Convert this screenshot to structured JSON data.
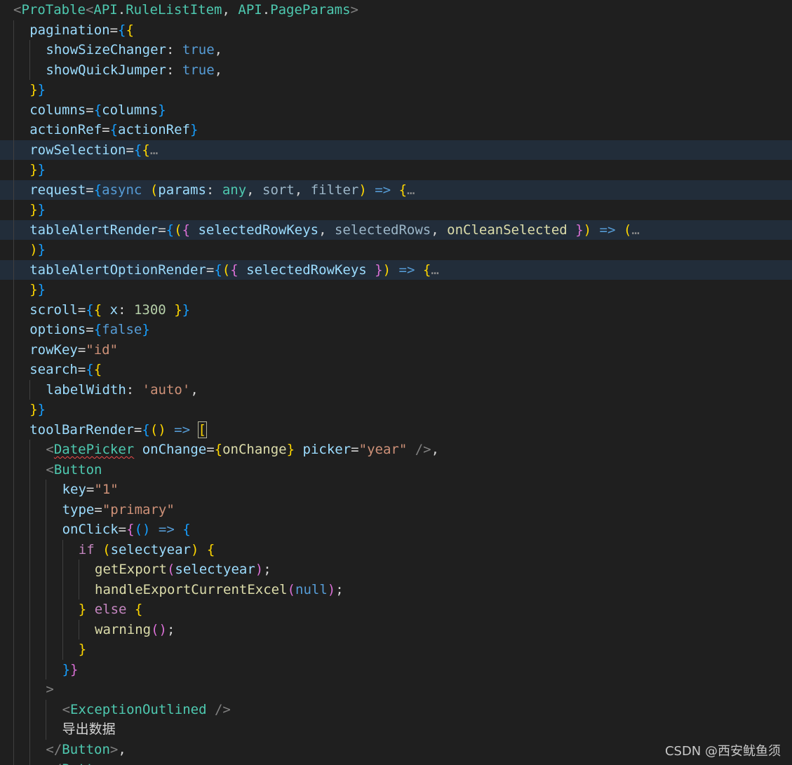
{
  "watermark": "CSDN @西安鱿鱼须",
  "colors": {
    "background": "#1f1f1f",
    "folded_line_highlight": "#222d3a",
    "indent_guide": "#404040",
    "tag": "#4ec9b0",
    "attribute": "#9cdcfe",
    "keyword": "#569cd6",
    "control": "#c586c0",
    "string": "#ce9178",
    "number": "#b5cea8",
    "function": "#dcdcaa",
    "bracket_level_1": "#ffd700",
    "bracket_level_2": "#da70d6",
    "bracket_level_3": "#179fff",
    "error_squiggle": "#f14c4c"
  },
  "lines": [
    {
      "indent": 0,
      "tokens": [
        [
          "t-tagbr",
          "<"
        ],
        [
          "t-tag",
          "ProTable"
        ],
        [
          "t-tagbr",
          "<"
        ],
        [
          "t-type",
          "API"
        ],
        [
          "t-op",
          "."
        ],
        [
          "t-type",
          "RuleListItem"
        ],
        [
          "t-op",
          ", "
        ],
        [
          "t-type",
          "API"
        ],
        [
          "t-op",
          "."
        ],
        [
          "t-type",
          "PageParams"
        ],
        [
          "t-tagbr",
          ">"
        ]
      ]
    },
    {
      "indent": 1,
      "tokens": [
        [
          "t-attr",
          "pagination"
        ],
        [
          "t-op",
          "="
        ],
        [
          "b3",
          "{"
        ],
        [
          "b1",
          "{"
        ]
      ]
    },
    {
      "indent": 2,
      "tokens": [
        [
          "t-var",
          "showSizeChanger"
        ],
        [
          "t-op",
          ": "
        ],
        [
          "t-kw",
          "true"
        ],
        [
          "t-op",
          ","
        ]
      ]
    },
    {
      "indent": 2,
      "tokens": [
        [
          "t-var",
          "showQuickJumper"
        ],
        [
          "t-op",
          ": "
        ],
        [
          "t-kw",
          "true"
        ],
        [
          "t-op",
          ","
        ]
      ]
    },
    {
      "indent": 1,
      "tokens": [
        [
          "b1",
          "}"
        ],
        [
          "b3",
          "}"
        ]
      ]
    },
    {
      "indent": 1,
      "tokens": [
        [
          "t-attr",
          "columns"
        ],
        [
          "t-op",
          "="
        ],
        [
          "b3",
          "{"
        ],
        [
          "t-var",
          "columns"
        ],
        [
          "b3",
          "}"
        ]
      ]
    },
    {
      "indent": 1,
      "tokens": [
        [
          "t-attr",
          "actionRef"
        ],
        [
          "t-op",
          "="
        ],
        [
          "b3",
          "{"
        ],
        [
          "t-var",
          "actionRef"
        ],
        [
          "b3",
          "}"
        ]
      ]
    },
    {
      "indent": 1,
      "folded": true,
      "tokens": [
        [
          "t-attr",
          "rowSelection"
        ],
        [
          "t-op",
          "="
        ],
        [
          "b3",
          "{"
        ],
        [
          "b1",
          "{"
        ],
        [
          "t-ell",
          "…"
        ]
      ]
    },
    {
      "indent": 1,
      "tokens": [
        [
          "b1",
          "}"
        ],
        [
          "b3",
          "}"
        ]
      ]
    },
    {
      "indent": 1,
      "folded": true,
      "tokens": [
        [
          "t-attr",
          "request"
        ],
        [
          "t-op",
          "="
        ],
        [
          "b3",
          "{"
        ],
        [
          "t-kw",
          "async"
        ],
        [
          "t-op",
          " "
        ],
        [
          "b1",
          "("
        ],
        [
          "t-var",
          "params"
        ],
        [
          "t-op",
          ": "
        ],
        [
          "t-type",
          "any"
        ],
        [
          "t-op",
          ", "
        ],
        [
          "t-dim",
          "sort"
        ],
        [
          "t-op",
          ", "
        ],
        [
          "t-dim",
          "filter"
        ],
        [
          "b1",
          ")"
        ],
        [
          "t-op",
          " "
        ],
        [
          "t-kw",
          "=>"
        ],
        [
          "t-op",
          " "
        ],
        [
          "b1",
          "{"
        ],
        [
          "t-ell",
          "…"
        ]
      ]
    },
    {
      "indent": 1,
      "tokens": [
        [
          "b1",
          "}"
        ],
        [
          "b3",
          "}"
        ]
      ]
    },
    {
      "indent": 1,
      "folded": true,
      "tokens": [
        [
          "t-attr",
          "tableAlertRender"
        ],
        [
          "t-op",
          "="
        ],
        [
          "b3",
          "{"
        ],
        [
          "b1",
          "("
        ],
        [
          "b2",
          "{"
        ],
        [
          "t-op",
          " "
        ],
        [
          "t-var",
          "selectedRowKeys"
        ],
        [
          "t-op",
          ", "
        ],
        [
          "t-dim",
          "selectedRows"
        ],
        [
          "t-op",
          ", "
        ],
        [
          "t-fn",
          "onCleanSelected"
        ],
        [
          "t-op",
          " "
        ],
        [
          "b2",
          "}"
        ],
        [
          "b1",
          ")"
        ],
        [
          "t-op",
          " "
        ],
        [
          "t-kw",
          "=>"
        ],
        [
          "t-op",
          " "
        ],
        [
          "b1",
          "("
        ],
        [
          "t-ell",
          "…"
        ]
      ]
    },
    {
      "indent": 1,
      "tokens": [
        [
          "b1",
          ")"
        ],
        [
          "b3",
          "}"
        ]
      ]
    },
    {
      "indent": 1,
      "folded": true,
      "tokens": [
        [
          "t-attr",
          "tableAlertOptionRender"
        ],
        [
          "t-op",
          "="
        ],
        [
          "b3",
          "{"
        ],
        [
          "b1",
          "("
        ],
        [
          "b2",
          "{"
        ],
        [
          "t-op",
          " "
        ],
        [
          "t-var",
          "selectedRowKeys"
        ],
        [
          "t-op",
          " "
        ],
        [
          "b2",
          "}"
        ],
        [
          "b1",
          ")"
        ],
        [
          "t-op",
          " "
        ],
        [
          "t-kw",
          "=>"
        ],
        [
          "t-op",
          " "
        ],
        [
          "b1",
          "{"
        ],
        [
          "t-ell",
          "…"
        ]
      ]
    },
    {
      "indent": 1,
      "tokens": [
        [
          "b1",
          "}"
        ],
        [
          "b3",
          "}"
        ]
      ]
    },
    {
      "indent": 1,
      "tokens": [
        [
          "t-attr",
          "scroll"
        ],
        [
          "t-op",
          "="
        ],
        [
          "b3",
          "{"
        ],
        [
          "b1",
          "{"
        ],
        [
          "t-op",
          " "
        ],
        [
          "t-var",
          "x"
        ],
        [
          "t-op",
          ": "
        ],
        [
          "t-num",
          "1300"
        ],
        [
          "t-op",
          " "
        ],
        [
          "b1",
          "}"
        ],
        [
          "b3",
          "}"
        ]
      ]
    },
    {
      "indent": 1,
      "tokens": [
        [
          "t-attr",
          "options"
        ],
        [
          "t-op",
          "="
        ],
        [
          "b3",
          "{"
        ],
        [
          "t-kw",
          "false"
        ],
        [
          "b3",
          "}"
        ]
      ]
    },
    {
      "indent": 1,
      "tokens": [
        [
          "t-attr",
          "rowKey"
        ],
        [
          "t-op",
          "="
        ],
        [
          "t-str",
          "\"id\""
        ]
      ]
    },
    {
      "indent": 1,
      "tokens": [
        [
          "t-attr",
          "search"
        ],
        [
          "t-op",
          "="
        ],
        [
          "b3",
          "{"
        ],
        [
          "b1",
          "{"
        ]
      ]
    },
    {
      "indent": 2,
      "tokens": [
        [
          "t-var",
          "labelWidth"
        ],
        [
          "t-op",
          ": "
        ],
        [
          "t-str",
          "'auto'"
        ],
        [
          "t-op",
          ","
        ]
      ]
    },
    {
      "indent": 1,
      "tokens": [
        [
          "b1",
          "}"
        ],
        [
          "b3",
          "}"
        ]
      ]
    },
    {
      "indent": 1,
      "tokens": [
        [
          "t-attr",
          "toolBarRender"
        ],
        [
          "t-op",
          "="
        ],
        [
          "b3",
          "{"
        ],
        [
          "b1",
          "()"
        ],
        [
          "t-op",
          " "
        ],
        [
          "t-kw",
          "=>"
        ],
        [
          "t-op",
          " "
        ],
        [
          "b1 bracket-match",
          "["
        ]
      ]
    },
    {
      "indent": 2,
      "tokens": [
        [
          "t-tagbr",
          "<"
        ],
        [
          "t-tag squiggle",
          "DatePicker"
        ],
        [
          "t-op",
          " "
        ],
        [
          "t-attr",
          "onChange"
        ],
        [
          "t-op",
          "="
        ],
        [
          "b1",
          "{"
        ],
        [
          "t-fn",
          "onChange"
        ],
        [
          "b1",
          "}"
        ],
        [
          "t-op",
          " "
        ],
        [
          "t-attr",
          "picker"
        ],
        [
          "t-op",
          "="
        ],
        [
          "t-str",
          "\"year\""
        ],
        [
          "t-op",
          " "
        ],
        [
          "t-tagbr",
          "/>"
        ],
        [
          "t-op",
          ","
        ]
      ]
    },
    {
      "indent": 2,
      "tokens": [
        [
          "t-tagbr",
          "<"
        ],
        [
          "t-tag",
          "Button"
        ]
      ]
    },
    {
      "indent": 3,
      "tokens": [
        [
          "t-attr",
          "key"
        ],
        [
          "t-op",
          "="
        ],
        [
          "t-str",
          "\"1\""
        ]
      ]
    },
    {
      "indent": 3,
      "tokens": [
        [
          "t-attr",
          "type"
        ],
        [
          "t-op",
          "="
        ],
        [
          "t-str",
          "\"primary\""
        ]
      ]
    },
    {
      "indent": 3,
      "tokens": [
        [
          "t-attr",
          "onClick"
        ],
        [
          "t-op",
          "="
        ],
        [
          "b2",
          "{"
        ],
        [
          "b3",
          "()"
        ],
        [
          "t-op",
          " "
        ],
        [
          "t-kw",
          "=>"
        ],
        [
          "t-op",
          " "
        ],
        [
          "b3",
          "{"
        ]
      ]
    },
    {
      "indent": 4,
      "tokens": [
        [
          "t-ctrl",
          "if"
        ],
        [
          "t-op",
          " "
        ],
        [
          "b1",
          "("
        ],
        [
          "t-var",
          "selectyear"
        ],
        [
          "b1",
          ")"
        ],
        [
          "t-op",
          " "
        ],
        [
          "b1",
          "{"
        ]
      ]
    },
    {
      "indent": 5,
      "tokens": [
        [
          "t-fn",
          "getExport"
        ],
        [
          "b2",
          "("
        ],
        [
          "t-var",
          "selectyear"
        ],
        [
          "b2",
          ")"
        ],
        [
          "t-op",
          ";"
        ]
      ]
    },
    {
      "indent": 5,
      "tokens": [
        [
          "t-fn",
          "handleExportCurrentExcel"
        ],
        [
          "b2",
          "("
        ],
        [
          "t-kw",
          "null"
        ],
        [
          "b2",
          ")"
        ],
        [
          "t-op",
          ";"
        ]
      ]
    },
    {
      "indent": 4,
      "tokens": [
        [
          "b1",
          "}"
        ],
        [
          "t-op",
          " "
        ],
        [
          "t-ctrl",
          "else"
        ],
        [
          "t-op",
          " "
        ],
        [
          "b1",
          "{"
        ]
      ]
    },
    {
      "indent": 5,
      "tokens": [
        [
          "t-fn",
          "warning"
        ],
        [
          "b2",
          "()"
        ],
        [
          "t-op",
          ";"
        ]
      ]
    },
    {
      "indent": 4,
      "tokens": [
        [
          "b1",
          "}"
        ]
      ]
    },
    {
      "indent": 3,
      "tokens": [
        [
          "b3",
          "}"
        ],
        [
          "b2",
          "}"
        ]
      ]
    },
    {
      "indent": 2,
      "tokens": [
        [
          "t-tagbr",
          ">"
        ]
      ]
    },
    {
      "indent": 3,
      "tokens": [
        [
          "t-tagbr",
          "<"
        ],
        [
          "t-tag",
          "ExceptionOutlined"
        ],
        [
          "t-op",
          " "
        ],
        [
          "t-tagbr",
          "/>"
        ]
      ]
    },
    {
      "indent": 3,
      "tokens": [
        [
          "t-text",
          "导出数据"
        ]
      ]
    },
    {
      "indent": 2,
      "tokens": [
        [
          "t-tagbr",
          "</"
        ],
        [
          "t-tag",
          "Button"
        ],
        [
          "t-tagbr",
          ">"
        ],
        [
          "t-op",
          ","
        ]
      ]
    },
    {
      "indent": 2,
      "tokens": [
        [
          "t-tagbr",
          "</"
        ],
        [
          "t-tag",
          "Button"
        ],
        [
          "t-tagbr",
          ">"
        ]
      ]
    }
  ]
}
